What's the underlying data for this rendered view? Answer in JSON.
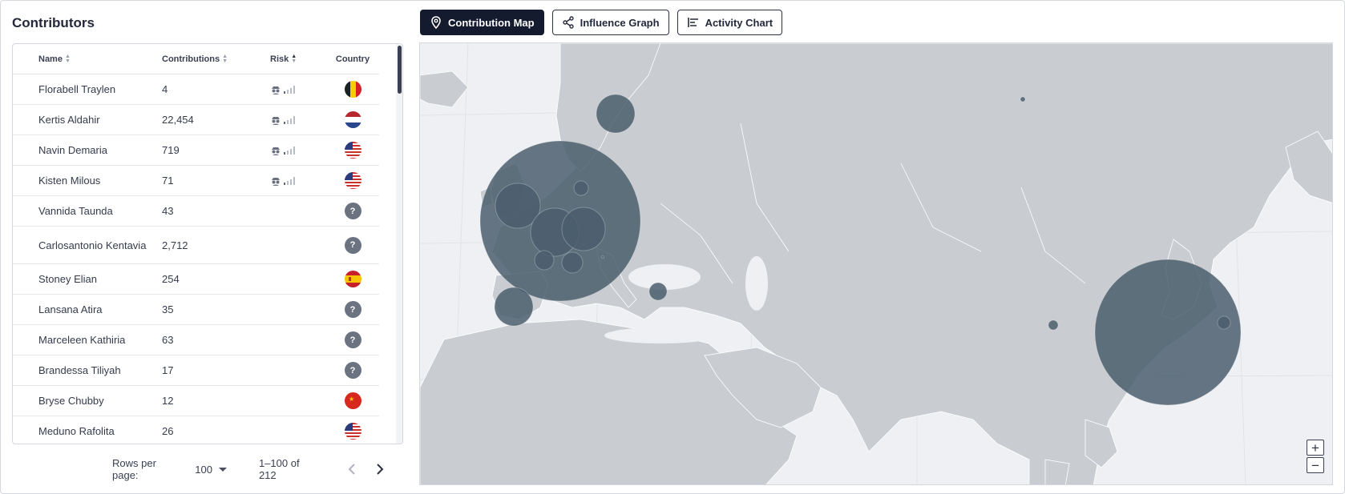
{
  "title": "Contributors",
  "table": {
    "headers": {
      "name": "Name",
      "contributions": "Contributions",
      "risk": "Risk",
      "country": "Country"
    },
    "rows": [
      {
        "name": "Florabell Traylen",
        "contributions": "4",
        "risk": true,
        "country": "belgium"
      },
      {
        "name": "Kertis Aldahir",
        "contributions": "22,454",
        "risk": true,
        "country": "netherlands"
      },
      {
        "name": "Navin Demaria",
        "contributions": "719",
        "risk": true,
        "country": "usa"
      },
      {
        "name": "Kisten Milous",
        "contributions": "71",
        "risk": true,
        "country": "usa"
      },
      {
        "name": "Vannida Taunda",
        "contributions": "43",
        "risk": false,
        "country": "unknown"
      },
      {
        "name": "Carlosantonio Kentavia",
        "contributions": "2,712",
        "risk": false,
        "country": "unknown"
      },
      {
        "name": "Stoney Elian",
        "contributions": "254",
        "risk": false,
        "country": "spain"
      },
      {
        "name": "Lansana Atira",
        "contributions": "35",
        "risk": false,
        "country": "unknown"
      },
      {
        "name": "Marceleen Kathiria",
        "contributions": "63",
        "risk": false,
        "country": "unknown"
      },
      {
        "name": "Brandessa Tiliyah",
        "contributions": "17",
        "risk": false,
        "country": "unknown"
      },
      {
        "name": "Bryse Chubby",
        "contributions": "12",
        "risk": false,
        "country": "china"
      },
      {
        "name": "Meduno Rafolita",
        "contributions": "26",
        "risk": false,
        "country": "usa"
      }
    ],
    "unknown_flag_glyph": "?"
  },
  "pagination": {
    "rows_per_page_label": "Rows per page:",
    "rows_per_page_value": "100",
    "range": "1–100 of 212"
  },
  "tabs": [
    {
      "label": "Contribution Map",
      "icon": "map-pin-icon",
      "active": true
    },
    {
      "label": "Influence Graph",
      "icon": "share-nodes-icon",
      "active": false
    },
    {
      "label": "Activity Chart",
      "icon": "bar-list-icon",
      "active": false
    }
  ],
  "map": {
    "zoom_in": "+",
    "zoom_out": "−",
    "land_color": "#c9ccd1",
    "water_color": "#eef0f3",
    "bubble_color": "#4b5e6d"
  },
  "colors": {
    "accent": "#151b2f",
    "text": "#2b3040"
  }
}
